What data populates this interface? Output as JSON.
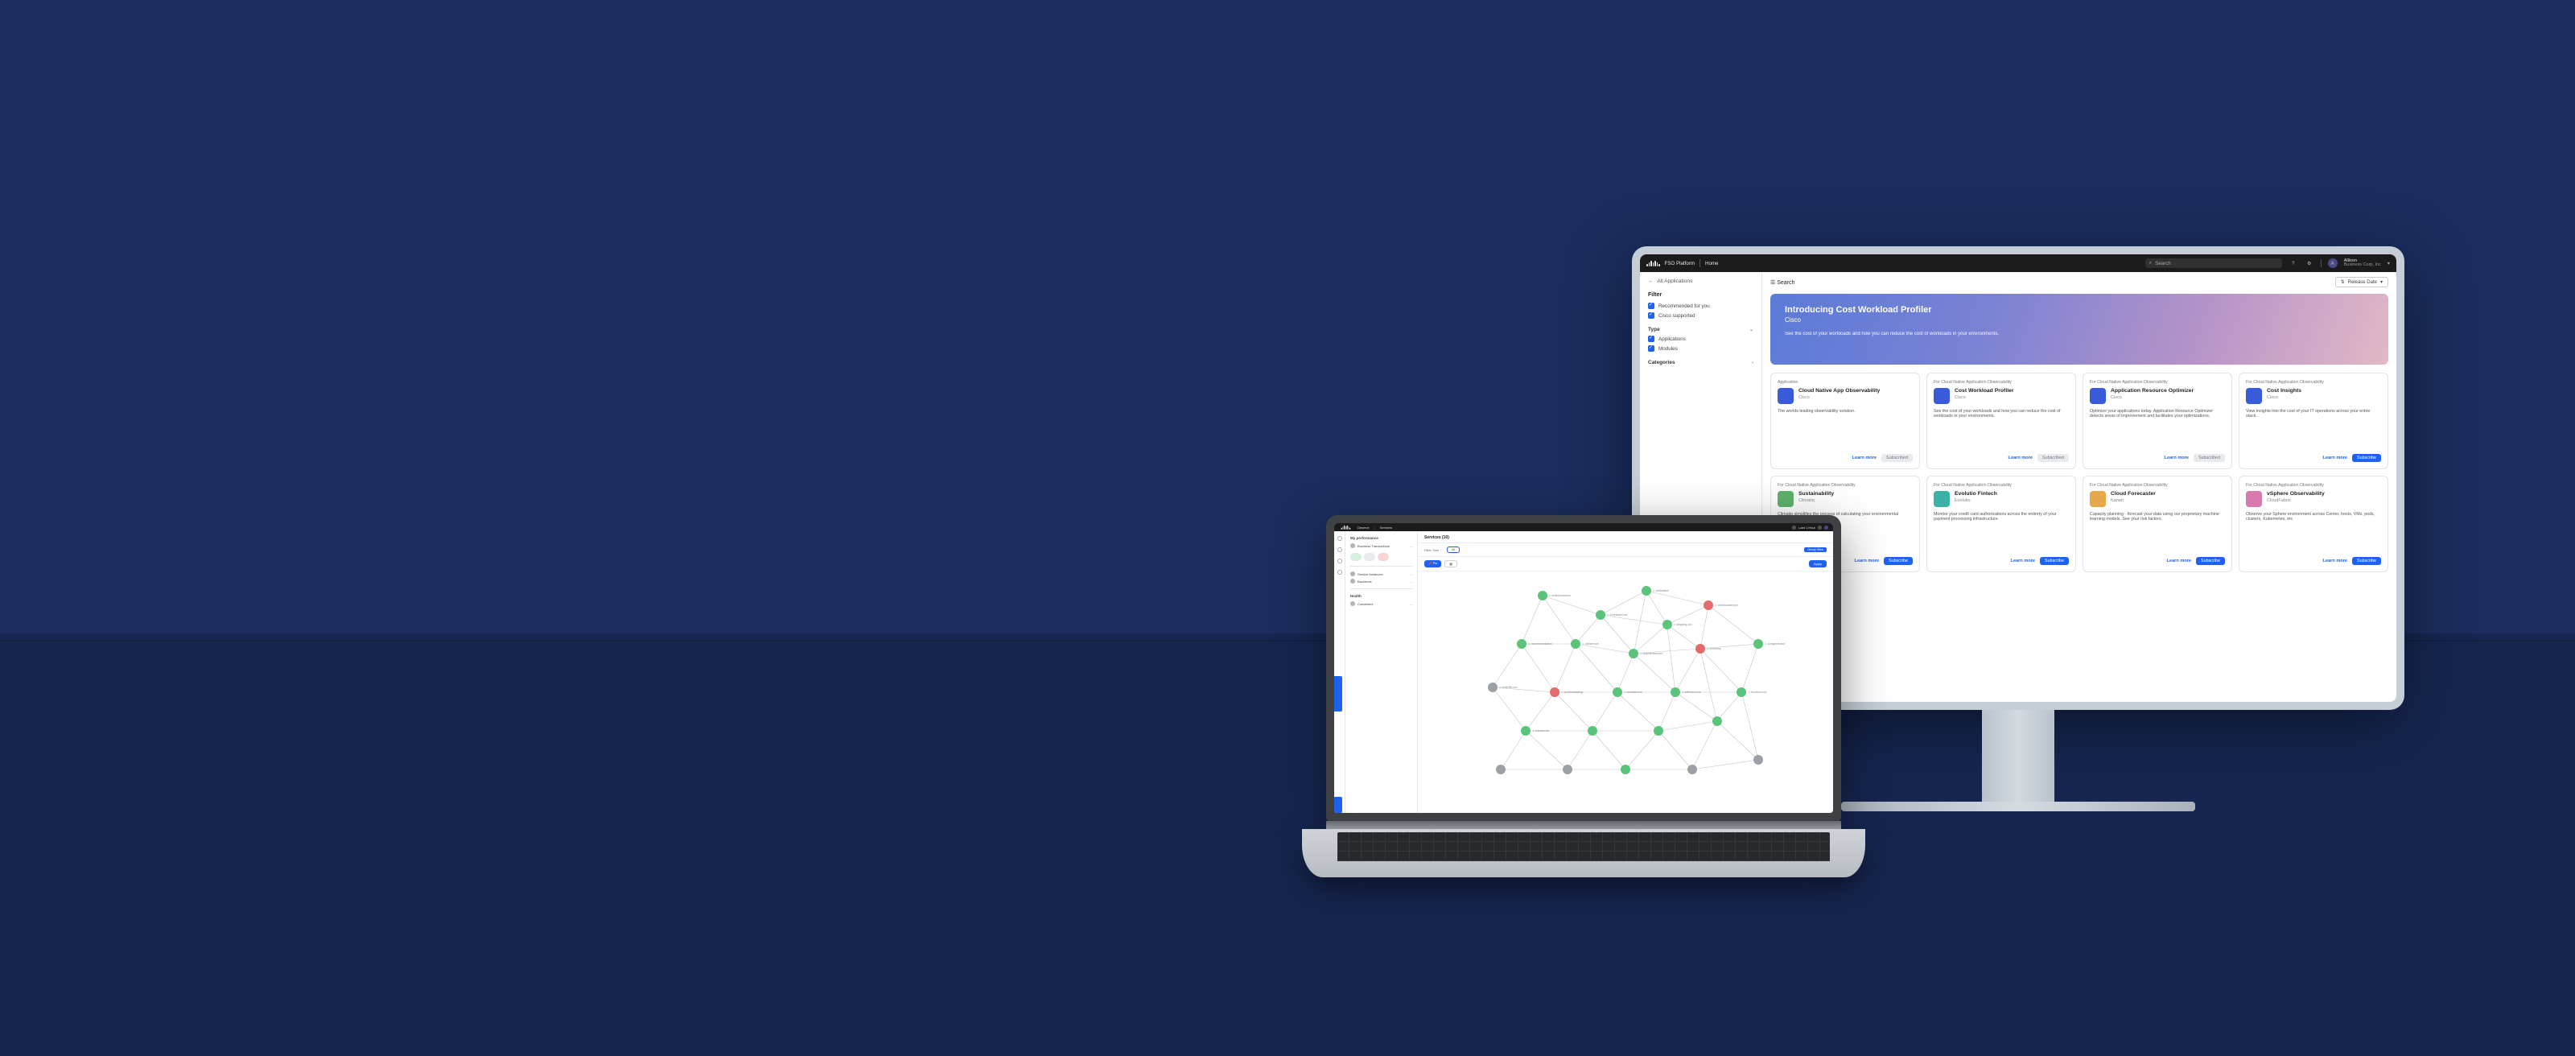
{
  "monitor": {
    "topbar": {
      "brand": "cisco",
      "product": "FSO Platform",
      "nav_home": "Home",
      "search_placeholder": "Search",
      "user_name": "Allison",
      "user_org": "Business Corp, Inc"
    },
    "sidebar": {
      "search_placeholder": "Search",
      "back_label": "All Applications",
      "filter_heading": "Filter",
      "recommended": "Recommended for you",
      "cisco_supported": "Cisco supported",
      "type_heading": "Type",
      "type_applications": "Applications",
      "type_modules": "Modules",
      "categories_heading": "Categories"
    },
    "content": {
      "breadcrumb": "All Applications",
      "release_button": "Release Date",
      "banner_title": "Introducing Cost Workload Profiler",
      "banner_vendor": "Cisco",
      "banner_sub": "See the cost of your workloads and how you can reduce the cost of workloads in your environments."
    },
    "labels": {
      "learn_more": "Learn more",
      "subscribe": "Subscribe",
      "subscribed": "Subscribed",
      "kicker_app": "Application",
      "kicker_cno": "For Cloud Native Application Observability"
    },
    "cards": [
      {
        "tile": "t-blue",
        "kicker_key": "kicker_app",
        "title": "Cloud Native App Observability",
        "vendor": "Cisco",
        "desc": "The worlds leading observability solution.",
        "state": "subscribed"
      },
      {
        "tile": "t-blue",
        "kicker_key": "kicker_cno",
        "title": "Cost Workload Profiler",
        "vendor": "Cisco",
        "desc": "See the cost of your workloads and how you can reduce the cost of workloads in your environments.",
        "state": "subscribed"
      },
      {
        "tile": "t-blue",
        "kicker_key": "kicker_cno",
        "title": "Application Resource Optimizer",
        "vendor": "Cisco",
        "desc": "Optimize your applications today. Application Resource Optimizer detects areas of improvement and facilitates your optimizations.",
        "state": "subscribed"
      },
      {
        "tile": "t-blue",
        "kicker_key": "kicker_cno",
        "title": "Cost Insights",
        "vendor": "Cisco",
        "desc": "View insights into the cost of your IT operations across your entire stack.",
        "state": "subscribe"
      },
      {
        "tile": "t-green",
        "kicker_key": "kicker_cno",
        "title": "Sustainability",
        "vendor": "Climatiq",
        "desc": "Climatiq simplifies the process of calculating your environmental footprint.",
        "state": "subscribe"
      },
      {
        "tile": "t-teal",
        "kicker_key": "kicker_cno",
        "title": "Evolutio Fintech",
        "vendor": "Evolutio",
        "desc": "Monitor your credit card authorizations across the entirety of your payment processing infrastructure",
        "state": "subscribe"
      },
      {
        "tile": "t-orange",
        "kicker_key": "kicker_cno",
        "title": "Cloud Forecaster",
        "vendor": "Kanari",
        "desc": "Capacity planning - forecast your data using our proprietary machine learning models. See your risk factors.",
        "state": "subscribe"
      },
      {
        "tile": "t-pink",
        "kicker_key": "kicker_cno",
        "title": "vSphere Observability",
        "vendor": "CloudFabrix",
        "desc": "Observe your Sphere environment across Center, hosts, VMs, pods, clusters, Kubernetes, etc",
        "state": "subscribe"
      }
    ]
  },
  "laptop": {
    "topbar": {
      "left1": "Observe",
      "left2": "Services",
      "right1": "Last 1 Hour"
    },
    "left_title": "My performance",
    "left_rows": [
      "Business Transactions",
      "Service Instances",
      "Backends",
      "Containers"
    ],
    "left_health": "Health",
    "main_title": "Services (10)",
    "filter_label": "Filter Tree",
    "group_tag": "Group View",
    "pin_label": "Pin",
    "all_chip": "All",
    "apply": "Apply",
    "node_labels": [
      "orderprocessor",
      "verification",
      "checkoutservice",
      "eurekaservice",
      "shipping-svc",
      "recommendation",
      "cartservice",
      "paymentservice",
      "inventory",
      "loadgenerator",
      "orderfile-svc",
      "productcatalog",
      "emailservice",
      "fulfilment-svc",
      "frontend-svc",
      "zuulservice"
    ]
  }
}
